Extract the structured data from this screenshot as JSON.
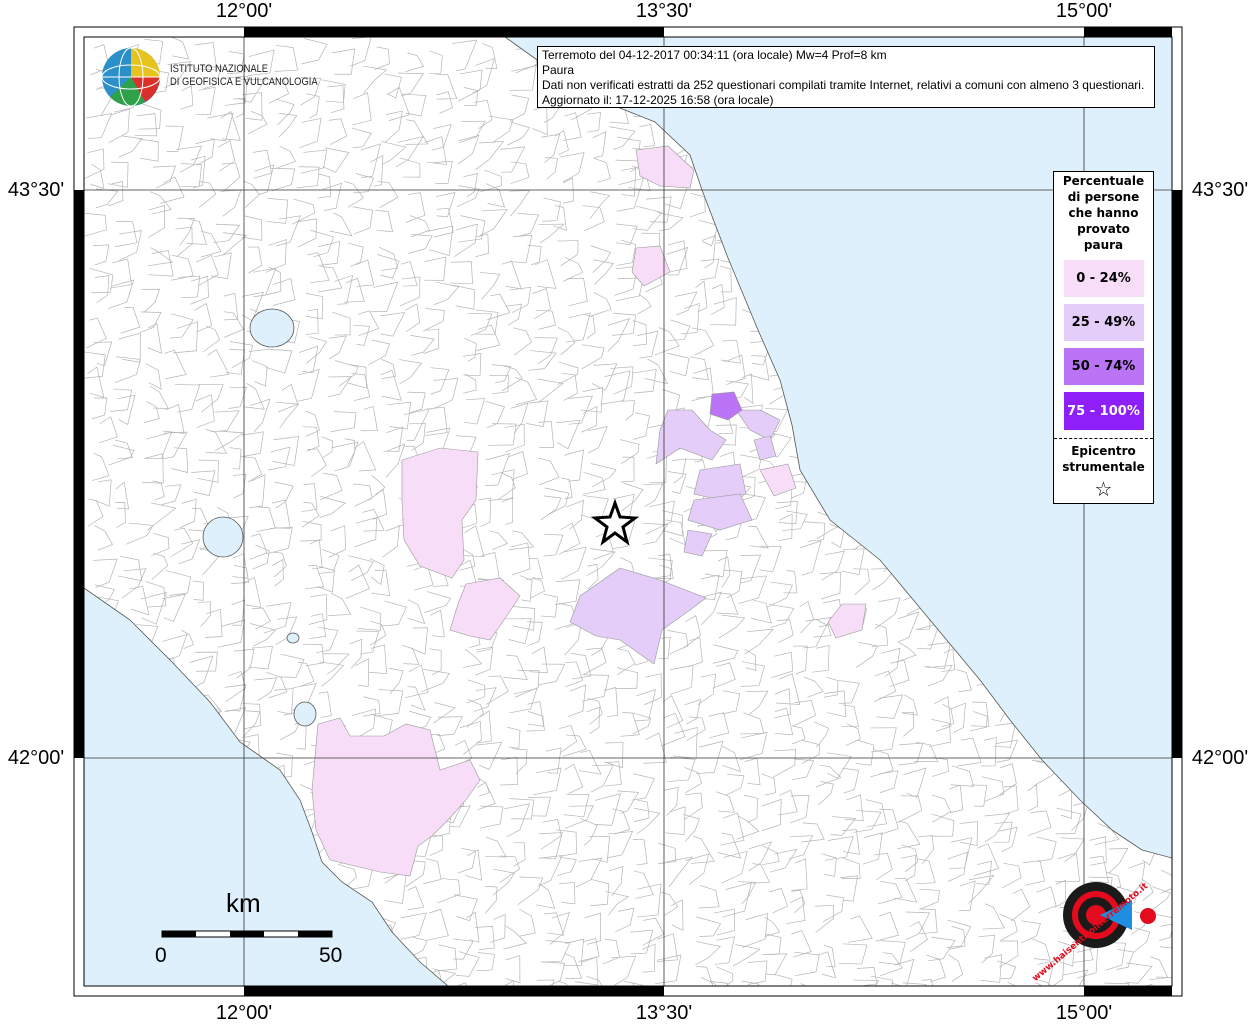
{
  "info": {
    "line1": "Terremoto del 04-12-2017 00:34:11 (ora locale) Mw=4 Prof=8 km",
    "line2": "Paura",
    "line3": "Dati non verificati estratti da 252 questionari compilati tramite Internet, relativi a comuni con almeno 3 questionari.",
    "line4": "Aggiornato il: 17-12-2025 16:58 (ora locale)"
  },
  "logo": {
    "org": "ISTITUTO NAZIONALE",
    "org2": "DI GEOFISICA E VULCANOLOGIA",
    "badge": "www.haisentitoilterremoto.it"
  },
  "axes": {
    "lon": [
      "12°00'",
      "13°30'",
      "15°00'"
    ],
    "lat": [
      "43°30'",
      "42°00'"
    ]
  },
  "legend": {
    "title": [
      "Percentuale",
      "di persone",
      "che hanno",
      "provato",
      "paura"
    ],
    "classes": [
      {
        "label": "0 - 24%",
        "color": "#f8ddf8",
        "text": "#000"
      },
      {
        "label": "25 - 49%",
        "color": "#e4cdf8",
        "text": "#000"
      },
      {
        "label": "50 - 74%",
        "color": "#bc74f7",
        "text": "#000"
      },
      {
        "label": "75 - 100%",
        "color": "#8f1ff8",
        "text": "#fff"
      }
    ],
    "epicenter": [
      "Epicentro",
      "strumentale"
    ],
    "epicenter_icon": "star-outline-icon"
  },
  "scale": {
    "unit": "km",
    "min": "0",
    "max": "50"
  },
  "colors": {
    "sea": "#ddf0fb",
    "land": "#ffffff",
    "borders": "#b0b0b0"
  }
}
